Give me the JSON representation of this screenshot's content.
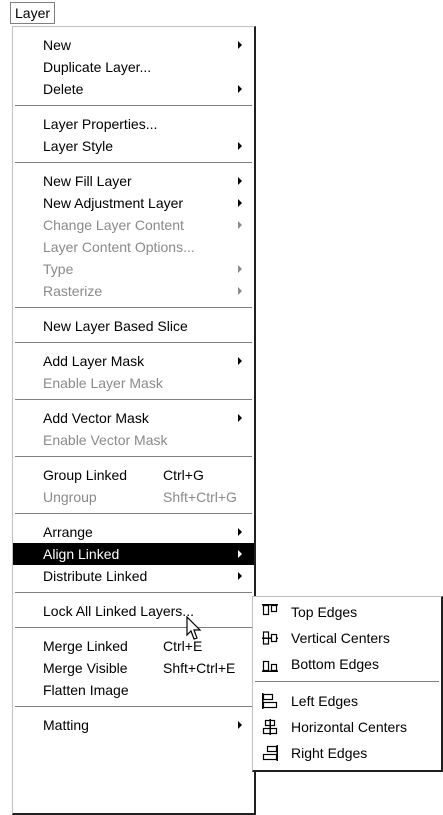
{
  "menubar": {
    "title": "Layer"
  },
  "menu": {
    "groups": [
      [
        {
          "label": "New",
          "submenu": true,
          "disabled": false
        },
        {
          "label": "Duplicate Layer...",
          "submenu": false,
          "disabled": false
        },
        {
          "label": "Delete",
          "submenu": true,
          "disabled": false
        }
      ],
      [
        {
          "label": "Layer Properties...",
          "submenu": false,
          "disabled": false
        },
        {
          "label": "Layer Style",
          "submenu": true,
          "disabled": false
        }
      ],
      [
        {
          "label": "New Fill Layer",
          "submenu": true,
          "disabled": false
        },
        {
          "label": "New Adjustment Layer",
          "submenu": true,
          "disabled": false
        },
        {
          "label": "Change Layer Content",
          "submenu": true,
          "disabled": true
        },
        {
          "label": "Layer Content Options...",
          "submenu": false,
          "disabled": true
        },
        {
          "label": "Type",
          "submenu": true,
          "disabled": true
        },
        {
          "label": "Rasterize",
          "submenu": true,
          "disabled": true
        }
      ],
      [
        {
          "label": "New Layer Based Slice",
          "submenu": false,
          "disabled": false
        }
      ],
      [
        {
          "label": "Add Layer Mask",
          "submenu": true,
          "disabled": false
        },
        {
          "label": "Enable Layer Mask",
          "submenu": false,
          "disabled": true
        }
      ],
      [
        {
          "label": "Add Vector Mask",
          "submenu": true,
          "disabled": false
        },
        {
          "label": "Enable Vector Mask",
          "submenu": false,
          "disabled": true
        }
      ],
      [
        {
          "label": "Group Linked",
          "shortcut": "Ctrl+G",
          "submenu": false,
          "disabled": false
        },
        {
          "label": "Ungroup",
          "shortcut": "Shft+Ctrl+G",
          "submenu": false,
          "disabled": true
        }
      ],
      [
        {
          "label": "Arrange",
          "submenu": true,
          "disabled": false
        },
        {
          "label": "Align Linked",
          "submenu": true,
          "disabled": false,
          "selected": true
        },
        {
          "label": "Distribute Linked",
          "submenu": true,
          "disabled": false
        }
      ],
      [
        {
          "label": "Lock All Linked Layers...",
          "submenu": false,
          "disabled": false
        }
      ],
      [
        {
          "label": "Merge Linked",
          "shortcut": "Ctrl+E",
          "submenu": false,
          "disabled": false
        },
        {
          "label": "Merge Visible",
          "shortcut": "Shft+Ctrl+E",
          "submenu": false,
          "disabled": false
        },
        {
          "label": "Flatten Image",
          "submenu": false,
          "disabled": false
        }
      ],
      [
        {
          "label": "Matting",
          "submenu": true,
          "disabled": false
        }
      ]
    ]
  },
  "submenu": {
    "groups": [
      [
        {
          "label": "Top Edges",
          "icon": "align-top-edges-icon"
        },
        {
          "label": "Vertical Centers",
          "icon": "align-vertical-centers-icon"
        },
        {
          "label": "Bottom Edges",
          "icon": "align-bottom-edges-icon"
        }
      ],
      [
        {
          "label": "Left Edges",
          "icon": "align-left-edges-icon"
        },
        {
          "label": "Horizontal Centers",
          "icon": "align-horizontal-centers-icon"
        },
        {
          "label": "Right Edges",
          "icon": "align-right-edges-icon"
        }
      ]
    ]
  }
}
